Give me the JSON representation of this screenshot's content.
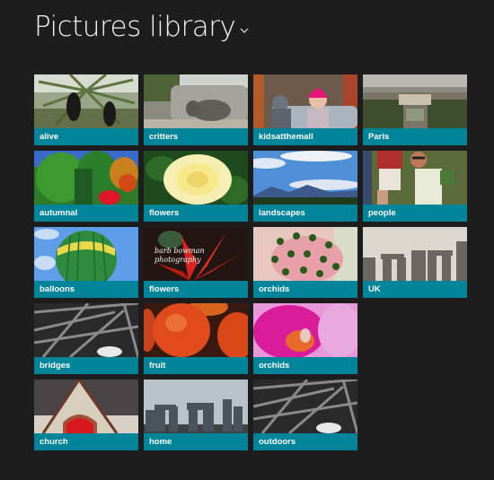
{
  "header": {
    "title": "Pictures library",
    "dropdown_icon": "chevron-down-icon"
  },
  "colors": {
    "background": "#1d1d1d",
    "label_bar": "#00849a",
    "label_text": "#ffffff",
    "title_text": "#f2f2f2"
  },
  "tiles": [
    {
      "label": "alive",
      "thumb": "palm tree with chimpanzees"
    },
    {
      "label": "critters",
      "thumb": "elephant by rocks"
    },
    {
      "label": "kidsatthemall",
      "thumb": "kids in pink hat"
    },
    {
      "label": "Paris",
      "thumb": "aerial view of Paris"
    },
    {
      "label": "autumnal",
      "thumb": "colorful autumn garden"
    },
    {
      "label": "flowers",
      "thumb": "yellow rose"
    },
    {
      "label": "landscapes",
      "thumb": "blue sky with mountains"
    },
    {
      "label": "people",
      "thumb": "man with sunglasses"
    },
    {
      "label": "balloons",
      "thumb": "green hot air balloon"
    },
    {
      "label": "flowers",
      "thumb": "red flower",
      "watermark": "barb bowman photography"
    },
    {
      "label": "orchids",
      "thumb": "pink flower close-up"
    },
    {
      "label": "UK",
      "thumb": "Stonehenge sepia"
    },
    {
      "label": "bridges",
      "thumb": "covered bridge beams"
    },
    {
      "label": "fruit",
      "thumb": "red apples"
    },
    {
      "label": "orchids",
      "thumb": "magenta orchid"
    },
    {
      "label": "church",
      "thumb": "church with red door"
    },
    {
      "label": "home",
      "thumb": "Stonehenge"
    },
    {
      "label": "outdoors",
      "thumb": "covered bridge beams"
    }
  ]
}
